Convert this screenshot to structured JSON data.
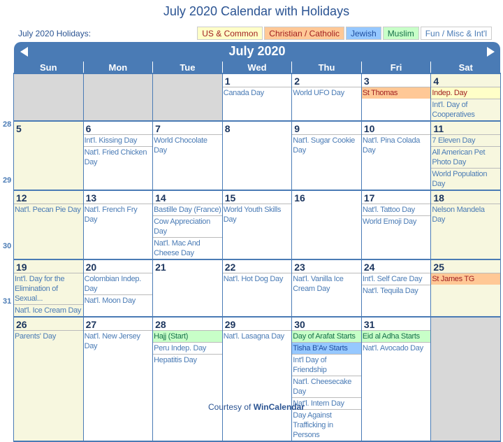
{
  "title": "July 2020 Calendar with Holidays",
  "holidays_label": "July 2020 Holidays:",
  "legend": [
    {
      "label": "US & Common",
      "cls": "us"
    },
    {
      "label": "Christian / Catholic",
      "cls": "chr"
    },
    {
      "label": "Jewish",
      "cls": "jew"
    },
    {
      "label": "Muslim",
      "cls": "mus"
    },
    {
      "label": "Fun / Misc & Int'l",
      "cls": "fun"
    }
  ],
  "month_title": "July 2020",
  "weekdays": [
    "Sun",
    "Mon",
    "Tue",
    "Wed",
    "Thu",
    "Fri",
    "Sat"
  ],
  "week_numbers": [
    "",
    "28",
    "29",
    "30",
    "31"
  ],
  "weeks": [
    [
      {
        "empty": true
      },
      {
        "empty": true
      },
      {
        "empty": true
      },
      {
        "day": "1",
        "events": [
          {
            "t": "Canada Day"
          }
        ]
      },
      {
        "day": "2",
        "events": [
          {
            "t": "World UFO Day"
          }
        ]
      },
      {
        "day": "3",
        "events": [
          {
            "t": "St Thomas",
            "c": "chr"
          }
        ]
      },
      {
        "day": "4",
        "wk": true,
        "events": [
          {
            "t": "Indep. Day",
            "c": "us"
          },
          {
            "t": "Int'l. Day of Cooperatives"
          }
        ]
      }
    ],
    [
      {
        "day": "5",
        "wk": true,
        "events": []
      },
      {
        "day": "6",
        "events": [
          {
            "t": "Int'l. Kissing Day"
          },
          {
            "t": "Nat'l. Fried Chicken Day"
          }
        ]
      },
      {
        "day": "7",
        "events": [
          {
            "t": "World Chocolate Day"
          }
        ]
      },
      {
        "day": "8",
        "events": []
      },
      {
        "day": "9",
        "events": [
          {
            "t": "Nat'l. Sugar Cookie Day"
          }
        ]
      },
      {
        "day": "10",
        "events": [
          {
            "t": "Nat'l. Pina Colada Day"
          }
        ]
      },
      {
        "day": "11",
        "wk": true,
        "events": [
          {
            "t": "7 Eleven Day"
          },
          {
            "t": "All American Pet Photo Day"
          },
          {
            "t": "World Population Day"
          }
        ]
      }
    ],
    [
      {
        "day": "12",
        "wk": true,
        "events": [
          {
            "t": "Nat'l. Pecan Pie Day"
          }
        ]
      },
      {
        "day": "13",
        "events": [
          {
            "t": "Nat'l. French Fry Day"
          }
        ]
      },
      {
        "day": "14",
        "events": [
          {
            "t": "Bastille Day (France)"
          },
          {
            "t": "Cow Appreciation Day"
          },
          {
            "t": "Nat'l. Mac And Cheese Day"
          }
        ]
      },
      {
        "day": "15",
        "events": [
          {
            "t": "World Youth Skills Day"
          }
        ]
      },
      {
        "day": "16",
        "events": []
      },
      {
        "day": "17",
        "events": [
          {
            "t": "Nat'l. Tattoo Day"
          },
          {
            "t": "World Emoji Day"
          }
        ]
      },
      {
        "day": "18",
        "wk": true,
        "events": [
          {
            "t": "Nelson Mandela Day"
          }
        ]
      }
    ],
    [
      {
        "day": "19",
        "wk": true,
        "events": [
          {
            "t": "Int'l. Day for the Elimination of Sexual..."
          },
          {
            "t": "Nat'l. Ice Cream Day"
          }
        ]
      },
      {
        "day": "20",
        "events": [
          {
            "t": "Colombian Indep. Day"
          },
          {
            "t": "Nat'l. Moon Day"
          }
        ]
      },
      {
        "day": "21",
        "events": []
      },
      {
        "day": "22",
        "events": [
          {
            "t": "Nat'l. Hot Dog Day"
          }
        ]
      },
      {
        "day": "23",
        "events": [
          {
            "t": "Nat'l. Vanilla Ice Cream Day"
          }
        ]
      },
      {
        "day": "24",
        "events": [
          {
            "t": "Int'l. Self Care Day"
          },
          {
            "t": "Nat'l. Tequila Day"
          }
        ]
      },
      {
        "day": "25",
        "wk": true,
        "events": [
          {
            "t": "St James TG",
            "c": "chr"
          }
        ]
      }
    ],
    [
      {
        "day": "26",
        "wk": true,
        "events": [
          {
            "t": "Parents' Day"
          }
        ]
      },
      {
        "day": "27",
        "events": [
          {
            "t": "Nat'l. New Jersey Day"
          }
        ]
      },
      {
        "day": "28",
        "events": [
          {
            "t": "Hajj (Start)",
            "c": "mus"
          },
          {
            "t": "Peru Indep. Day"
          },
          {
            "t": "Hepatitis Day"
          }
        ]
      },
      {
        "day": "29",
        "events": [
          {
            "t": "Nat'l. Lasagna Day"
          }
        ]
      },
      {
        "day": "30",
        "events": [
          {
            "t": "Day of Arafat Starts",
            "c": "mus"
          },
          {
            "t": "Tisha B'Av Starts",
            "c": "jew"
          },
          {
            "t": "Int'l Day of Friendship"
          },
          {
            "t": "Nat'l. Cheesecake Day"
          },
          {
            "t": "Nat'l. Intern Day"
          },
          {
            "t": "Day Against Trafficking in Persons"
          }
        ]
      },
      {
        "day": "31",
        "events": [
          {
            "t": "Eid al Adha Starts",
            "c": "mus"
          },
          {
            "t": "Nat'l. Avocado Day"
          }
        ]
      },
      {
        "empty": true
      }
    ]
  ],
  "footer": {
    "prefix": "Courtesy of",
    "link": "WinCalendar"
  },
  "colors": {
    "header": "#4a7bb5",
    "weekend": "#f7f7df",
    "empty": "#d8d8d8",
    "us": "#ffffc8",
    "christian": "#ffc896",
    "jewish": "#96c8ff",
    "muslim": "#c8ffc8"
  }
}
